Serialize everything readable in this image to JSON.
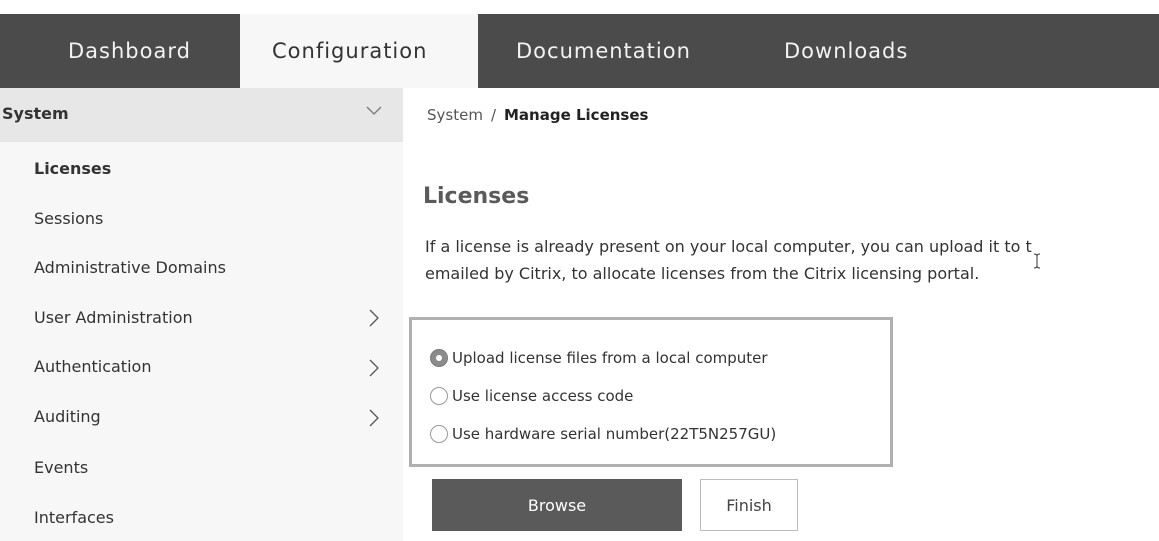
{
  "nav": {
    "tabs": [
      {
        "label": "Dashboard"
      },
      {
        "label": "Configuration"
      },
      {
        "label": "Documentation"
      },
      {
        "label": "Downloads"
      }
    ],
    "active_tab": "Configuration"
  },
  "sidebar": {
    "section_title": "System",
    "items": [
      {
        "label": "Licenses"
      },
      {
        "label": "Sessions"
      },
      {
        "label": "Administrative Domains"
      },
      {
        "label": "User Administration"
      },
      {
        "label": "Authentication"
      },
      {
        "label": "Auditing"
      },
      {
        "label": "Events"
      },
      {
        "label": "Interfaces"
      }
    ]
  },
  "breadcrumb": {
    "root": "System",
    "separator": "/",
    "current": "Manage Licenses"
  },
  "main": {
    "title": "Licenses",
    "description_line1": "If a license is already present on your local computer, you can upload it to t",
    "description_line2": "emailed by Citrix, to allocate licenses from the Citrix licensing portal.",
    "options": [
      {
        "label": "Upload license files from a local computer",
        "selected": true
      },
      {
        "label": "Use license access code",
        "selected": false
      },
      {
        "label": "Use hardware serial number(22T5N257GU)",
        "selected": false
      }
    ],
    "browse_label": "Browse",
    "finish_label": "Finish"
  },
  "colors": {
    "nav_bg": "#4b4b4b",
    "active_tab_bg": "#f7f7f7",
    "sidebar_bg": "#f7f7f7",
    "sidebar_header_bg": "#e7e7e7",
    "primary_button": "#5a5a5a",
    "options_border": "#b0b0b0"
  },
  "icons": {
    "sidebar_header": "chevron-down-icon",
    "sidebar_expand": "chevron-right-icon",
    "cursor": "text-cursor-icon"
  }
}
